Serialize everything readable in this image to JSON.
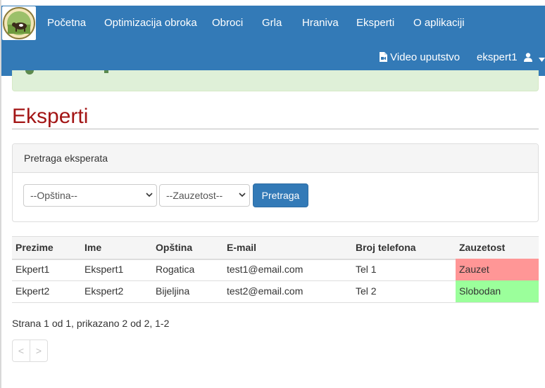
{
  "nav": {
    "items": [
      "Početna",
      "Optimizacija obroka",
      "Obroci",
      "Grla",
      "Hraniva",
      "Eksperti",
      "O aplikaciji"
    ],
    "video_label": "Video uputstvo",
    "user_label": "ekspert1"
  },
  "page": {
    "title": "Eksperti"
  },
  "search": {
    "panel_title": "Pretraga eksperata",
    "municipality_value": "--Opština--",
    "availability_value": "--Zauzetost--",
    "button_label": "Pretraga"
  },
  "table": {
    "headers": [
      "Prezime",
      "Ime",
      "Opština",
      "E-mail",
      "Broj telefona",
      "Zauzetost"
    ],
    "rows": [
      [
        "Ekpert1",
        "Ekspert1",
        "Rogatica",
        "test1@email.com",
        "Tel 1",
        "Zauzet"
      ],
      [
        "Ekpert2",
        "Ekspert2",
        "Bijeljina",
        "test2@email.com",
        "Tel 2",
        "Slobodan"
      ]
    ]
  },
  "pagination": {
    "summary": "Strana 1 od 1, prikazano 2 od 2, 1-2",
    "prev": "<",
    "next": ">"
  },
  "colors": {
    "navbar": "#337ab7",
    "title": "#a31515",
    "busy": "#ff9696",
    "free": "#9bff9b"
  }
}
